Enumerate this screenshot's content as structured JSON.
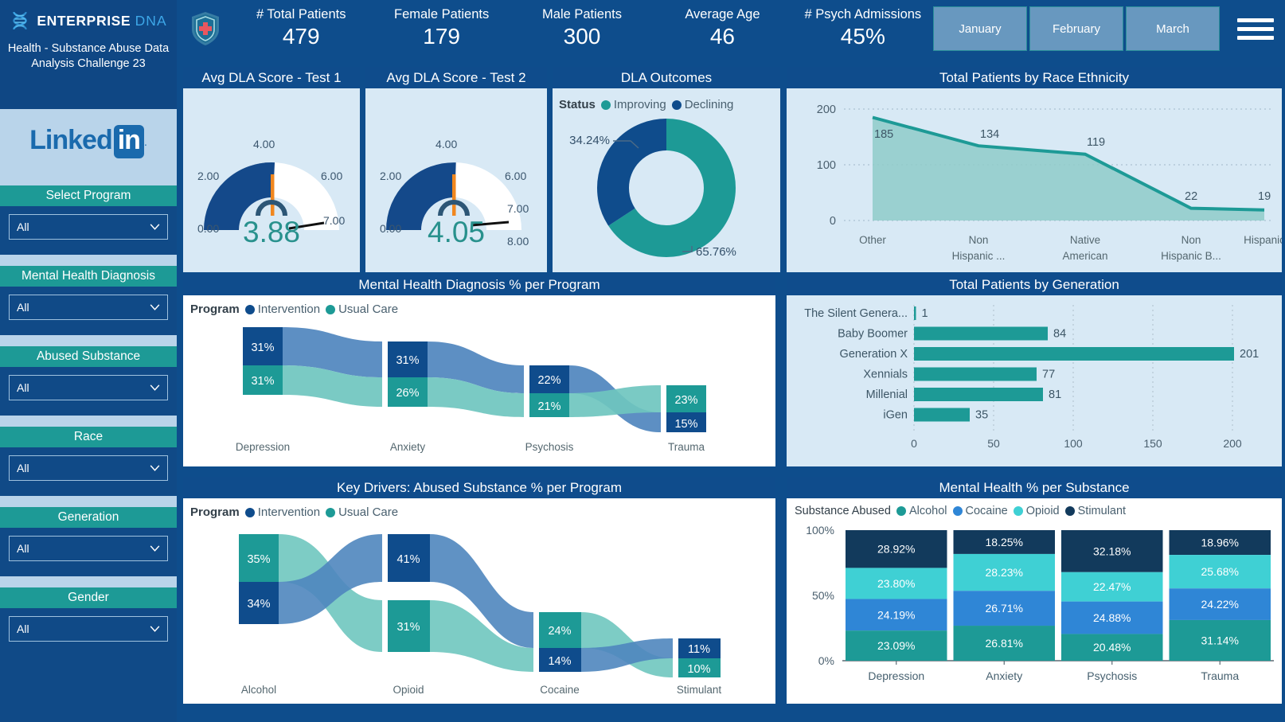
{
  "sidebar": {
    "brand_name": "ENTERPRISE",
    "brand_suffix": "DNA",
    "brand_icon": "dna-icon",
    "subtitle": "Health - Substance Abuse Data Analysis Challenge 23",
    "linkedin": {
      "text": "Linked",
      "badge": "in",
      "dot": "."
    },
    "filters": [
      {
        "title": "Select Program",
        "value": "All"
      },
      {
        "title": "Mental Health Diagnosis",
        "value": "All"
      },
      {
        "title": "Abused Substance",
        "value": "All"
      },
      {
        "title": "Race",
        "value": "All"
      },
      {
        "title": "Generation",
        "value": "All"
      },
      {
        "title": "Gender",
        "value": "All"
      }
    ]
  },
  "topbar": {
    "logo_icon": "medical-shield-icon",
    "menu_icon": "hamburger-menu-icon",
    "kpis": [
      {
        "label": "# Total Patients",
        "value": "479"
      },
      {
        "label": "Female Patients",
        "value": "179"
      },
      {
        "label": "Male Patients",
        "value": "300"
      },
      {
        "label": "Average Age",
        "value": "46"
      },
      {
        "label": "# Psych Admissions",
        "value": "45%"
      }
    ],
    "months": [
      "January",
      "February",
      "March"
    ]
  },
  "panels": {
    "gauge1_title": "Avg DLA Score - Test 1",
    "gauge2_title": "Avg DLA Score - Test 2",
    "donut_title": "DLA Outcomes",
    "race_title": "Total Patients by Race Ethnicity",
    "mh_sankey_title": "Mental Health Diagnosis % per Program",
    "generation_title": "Total Patients by Generation",
    "substance_sankey_title": "Key Drivers: Abused Substance % per Program",
    "mh_substance_title": "Mental Health % per Substance"
  },
  "colors": {
    "navy": "#0f4c8c",
    "teal": "#1d9a96",
    "light_teal": "#6fc6bf",
    "mid_blue": "#4f86be",
    "sky_blue": "#2f86d6",
    "cyan": "#3fd0d4",
    "dark_navy": "#123a5c",
    "orange": "#f0871f",
    "panel_bg": "#d8e9f5",
    "sidebar_bg": "#104a87"
  },
  "chart_data": [
    {
      "type": "gauge",
      "title": "Avg DLA Score - Test 1",
      "value": 3.88,
      "value_label": "3.88",
      "min": 0,
      "max": 7,
      "target": 4.0,
      "ticks": [
        "0.00",
        "2.00",
        "4.00",
        "6.00",
        "7.00"
      ]
    },
    {
      "type": "gauge",
      "title": "Avg DLA Score - Test 2",
      "value": 4.05,
      "value_label": "4.05",
      "min": 0,
      "max": 8,
      "target": 4.0,
      "ticks": [
        "0.00",
        "2.00",
        "4.00",
        "6.00",
        "7.00",
        "8.00"
      ]
    },
    {
      "type": "pie",
      "title": "DLA Outcomes",
      "legend_title": "Status",
      "legend_position": "top",
      "labels": [
        "Improving",
        "Declining"
      ],
      "values": [
        65.76,
        34.24
      ],
      "value_labels": [
        "65.76%",
        "34.24%"
      ],
      "colors": [
        "#1d9a96",
        "#0f4c8c"
      ]
    },
    {
      "type": "area",
      "title": "Total Patients by Race Ethnicity",
      "categories": [
        "Other",
        "Non Hispanic ...",
        "Native American",
        "Non Hispanic B...",
        "Hispanic"
      ],
      "values": [
        185,
        134,
        119,
        22,
        19
      ],
      "ylim": [
        0,
        200
      ],
      "yticks": [
        0,
        100,
        200
      ],
      "grid": true,
      "xlabel": "",
      "ylabel": ""
    },
    {
      "type": "sankey",
      "title": "Mental Health Diagnosis % per Program",
      "legend_title": "Program",
      "legend": [
        "Intervention",
        "Usual Care"
      ],
      "legend_colors": [
        "#0f4c8c",
        "#1d9a96"
      ],
      "stages": [
        "Depression",
        "Anxiety",
        "Psychosis",
        "Trauma"
      ],
      "series": [
        {
          "name": "Intervention",
          "values": [
            31,
            31,
            22,
            15
          ],
          "labels": [
            "31%",
            "31%",
            "22%",
            "15%"
          ]
        },
        {
          "name": "Usual Care",
          "values": [
            31,
            26,
            21,
            23
          ],
          "labels": [
            "31%",
            "26%",
            "21%",
            "23%"
          ]
        }
      ]
    },
    {
      "type": "bar",
      "title": "Total Patients by Generation",
      "orientation": "horizontal",
      "categories": [
        "The Silent Genera...",
        "Baby Boomer",
        "Generation X",
        "Xennials",
        "Millenial",
        "iGen"
      ],
      "values": [
        1,
        84,
        201,
        77,
        81,
        35
      ],
      "value_labels": [
        "1",
        "84",
        "201",
        "77",
        "81",
        "35"
      ],
      "xticks": [
        0,
        50,
        100,
        150,
        200
      ],
      "xlim": [
        0,
        210
      ],
      "color": "#1d9a96",
      "grid": true
    },
    {
      "type": "sankey",
      "title": "Key Drivers: Abused Substance % per Program",
      "legend_title": "Program",
      "legend": [
        "Intervention",
        "Usual Care"
      ],
      "legend_colors": [
        "#0f4c8c",
        "#1d9a96"
      ],
      "stages": [
        "Alcohol",
        "Opioid",
        "Cocaine",
        "Stimulant"
      ],
      "series": [
        {
          "name": "Intervention",
          "values": [
            34,
            41,
            14,
            11
          ],
          "labels": [
            "34%",
            "41%",
            "14%",
            "11%"
          ]
        },
        {
          "name": "Usual Care",
          "values": [
            35,
            31,
            24,
            10
          ],
          "labels": [
            "35%",
            "31%",
            "24%",
            "10%"
          ]
        }
      ]
    },
    {
      "type": "bar",
      "subtype": "stacked-100",
      "title": "Mental Health % per Substance",
      "legend_title": "Substance Abused",
      "categories": [
        "Depression",
        "Anxiety",
        "Psychosis",
        "Trauma"
      ],
      "yticks": [
        "0%",
        "50%",
        "100%"
      ],
      "ylim": [
        0,
        100
      ],
      "series": [
        {
          "name": "Alcohol",
          "color": "#1d9a96",
          "values": [
            23.09,
            26.81,
            20.48,
            31.14
          ],
          "labels": [
            "23.09%",
            "26.81%",
            "20.48%",
            "31.14%"
          ]
        },
        {
          "name": "Cocaine",
          "color": "#2f86d6",
          "values": [
            24.19,
            26.71,
            24.88,
            24.22
          ],
          "labels": [
            "24.19%",
            "26.71%",
            "24.88%",
            "24.22%"
          ]
        },
        {
          "name": "Opioid",
          "color": "#3fd0d4",
          "values": [
            23.8,
            28.23,
            22.47,
            25.68
          ],
          "labels": [
            "23.80%",
            "28.23%",
            "22.47%",
            "25.68%"
          ]
        },
        {
          "name": "Stimulant",
          "color": "#123a5c",
          "values": [
            28.92,
            18.25,
            32.18,
            18.96
          ],
          "labels": [
            "28.92%",
            "18.25%",
            "32.18%",
            "18.96%"
          ]
        }
      ]
    }
  ]
}
